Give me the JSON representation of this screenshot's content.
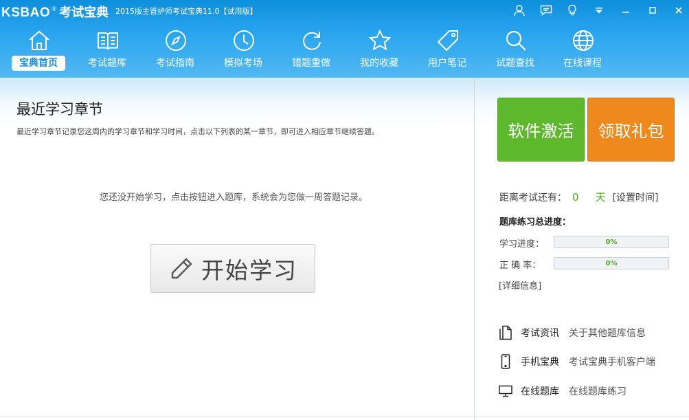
{
  "app": {
    "brand": "KSBAO",
    "reg_mark": "®",
    "name": "考试宝典",
    "title": "2015版主管护师考试宝典11.0【试用版】"
  },
  "nav": {
    "items": [
      {
        "label": "宝典首页",
        "icon": "home-icon",
        "active": true
      },
      {
        "label": "考试题库",
        "icon": "book-icon"
      },
      {
        "label": "考试指南",
        "icon": "compass-icon"
      },
      {
        "label": "模拟考场",
        "icon": "clock-icon"
      },
      {
        "label": "错题重做",
        "icon": "refresh-icon"
      },
      {
        "label": "我的收藏",
        "icon": "star-icon"
      },
      {
        "label": "用户笔记",
        "icon": "tag-icon"
      },
      {
        "label": "试题查找",
        "icon": "search-icon"
      },
      {
        "label": "在线课程",
        "icon": "globe-icon"
      }
    ]
  },
  "main": {
    "title": "最近学习章节",
    "description": "最近学习章节记录您这周内的学习章节和学习时间，点击以下列表的某一章节，即可进入相应章节继续答题。",
    "empty_message": "您还没开始学习，点击按钮进入题库，系统会为您做一周答题记录。",
    "start_button": "开始学习"
  },
  "side": {
    "activate_button": "软件激活",
    "gift_button": "领取礼包",
    "exam_countdown_label": "距离考试还有：",
    "exam_days": "0",
    "exam_days_unit": "天",
    "set_time_link": "[设置时间]",
    "progress_title": "题库练习总进度：",
    "study_progress_label": "学习进度：",
    "study_progress_value": "0%",
    "study_progress_fraction": 0,
    "accuracy_label": "正  确  率：",
    "accuracy_value": "0%",
    "accuracy_fraction": 0,
    "detail_link": "[详细信息]",
    "links": [
      {
        "icon": "document-icon",
        "name": "考试资讯",
        "desc": "关于其他题库信息"
      },
      {
        "icon": "mobile-icon",
        "name": "手机宝典",
        "desc": "考试宝典手机客户端"
      },
      {
        "icon": "monitor-icon",
        "name": "在线题库",
        "desc": "在线题库练习"
      }
    ]
  },
  "colors": {
    "header_top": "#0e8fdc",
    "header_bottom": "#52b8f3",
    "activate_green": "#5db82b",
    "gift_orange": "#f0891c",
    "progress_green": "#4fa81f"
  }
}
